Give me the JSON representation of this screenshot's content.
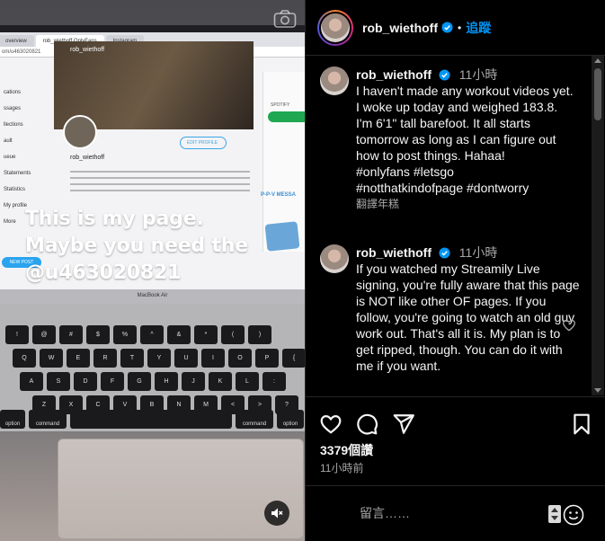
{
  "media": {
    "browser_tabs": [
      "overview",
      "rob_wiethoff OnlyFans",
      "Instagram"
    ],
    "address": "om/u463020821",
    "site_username": "rob_wiethoff",
    "site_nav": [
      "cations",
      "ssages",
      "llections",
      "ault",
      "ueue",
      "Statements",
      "Statistics",
      "My profile",
      "More"
    ],
    "edit_profile_label": "EDIT PROFILE",
    "ppv_label": "P-P-V MESSA",
    "spotify_label": "SPOTIFY",
    "new_post_label": "NEW POST",
    "laptop_model": "MacBook Air",
    "overlay_text": "This is my page.\nMaybe you need the\n@u463020821",
    "keys": {
      "row1": [
        "!",
        "@",
        "#",
        "$",
        "%",
        "^",
        "&",
        "*",
        "(",
        ")"
      ],
      "row2": [
        "Q",
        "W",
        "E",
        "R",
        "T",
        "Y",
        "U",
        "I",
        "O",
        "P",
        "{"
      ],
      "row3": [
        "A",
        "S",
        "D",
        "F",
        "G",
        "H",
        "J",
        "K",
        "L",
        ":"
      ],
      "row4": [
        "Z",
        "X",
        "C",
        "V",
        "B",
        "N",
        "M",
        "<",
        ">",
        "?"
      ],
      "row5": [
        "option",
        "command",
        "",
        "command",
        "option"
      ]
    }
  },
  "header": {
    "username": "rob_wiethoff",
    "separator": "•",
    "follow_label": "追蹤"
  },
  "comments": [
    {
      "username": "rob_wiethoff",
      "time": "11小時",
      "text": "I haven't made any workout videos yet.\nI woke up today and weighed 183.8.\nI'm 6'1\" tall barefoot. It all starts tomorrow as long as I can figure out how to post things. Hahaa!\n#onlyfans #letsgo\n#notthatkindofpage #dontworry",
      "translate": "翻譯年糕"
    },
    {
      "username": "rob_wiethoff",
      "time": "11小時",
      "text": "If you watched my Streamily Live signing, you're fully aware that this page is NOT like other OF pages. If you follow, you're going to watch an old guy work out. That's all it is. My plan is to get ripped, though. You can do it with me if you want."
    }
  ],
  "stats": {
    "likes": "3379個讚",
    "time": "11小時前"
  },
  "comment_box": {
    "placeholder": "留言……"
  }
}
